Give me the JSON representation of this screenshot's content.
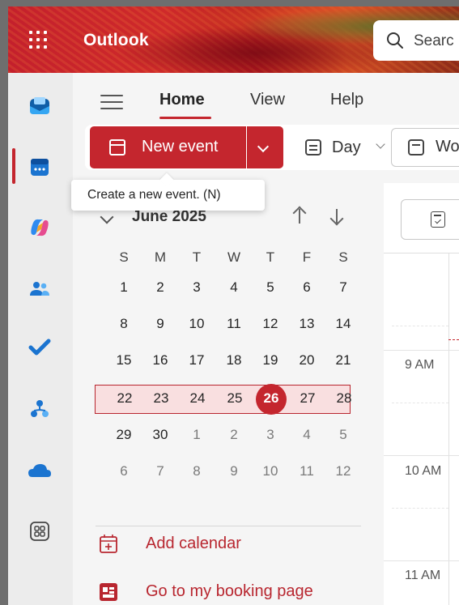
{
  "app": {
    "title": "Outlook",
    "search_placeholder": "Searc"
  },
  "rail": {
    "items": [
      {
        "name": "mail",
        "icon": "mail-icon"
      },
      {
        "name": "calendar",
        "icon": "calendar-icon",
        "active": true
      },
      {
        "name": "copilot",
        "icon": "copilot-icon"
      },
      {
        "name": "people",
        "icon": "people-icon"
      },
      {
        "name": "to-do",
        "icon": "todo-check-icon"
      },
      {
        "name": "org",
        "icon": "org-chart-icon"
      },
      {
        "name": "onedrive",
        "icon": "onedrive-cloud-icon"
      },
      {
        "name": "more-apps",
        "icon": "apps-grid-icon"
      }
    ]
  },
  "tabs": [
    "Home",
    "View",
    "Help"
  ],
  "ribbon": {
    "new_event": "New event",
    "day": "Day",
    "work_week": "Wo"
  },
  "tooltip": "Create a new event. (N)",
  "mini_calendar": {
    "month_label": "June 2025",
    "weekdays": [
      "S",
      "M",
      "T",
      "W",
      "T",
      "F",
      "S"
    ],
    "weeks": [
      [
        "1",
        "2",
        "3",
        "4",
        "5",
        "6",
        "7"
      ],
      [
        "8",
        "9",
        "10",
        "11",
        "12",
        "13",
        "14"
      ],
      [
        "15",
        "16",
        "17",
        "18",
        "19",
        "20",
        "21"
      ],
      [
        "22",
        "23",
        "24",
        "25",
        "26",
        "27",
        "28"
      ],
      [
        "29",
        "30",
        "1",
        "2",
        "3",
        "4",
        "5"
      ],
      [
        "6",
        "7",
        "8",
        "9",
        "10",
        "11",
        "12"
      ]
    ],
    "today": "26"
  },
  "links": {
    "add_calendar": "Add calendar",
    "booking_page": "Go to my booking page"
  },
  "grid": {
    "times": [
      "9 AM",
      "10 AM",
      "11 AM"
    ]
  },
  "colors": {
    "accent": "#c4262e",
    "selected_week_bg": "#f9dfe0"
  }
}
